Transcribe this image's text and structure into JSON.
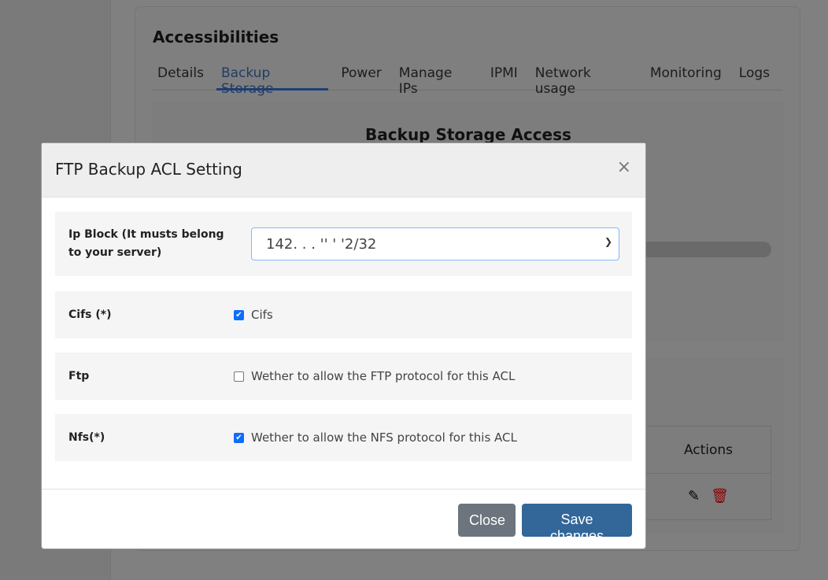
{
  "background": {
    "section_title": "Accessibilities",
    "tabs": [
      {
        "label": "Details"
      },
      {
        "label": "Backup Storage",
        "active": true
      },
      {
        "label": "Power"
      },
      {
        "label": "Manage IPs"
      },
      {
        "label": "IPMI"
      },
      {
        "label": "Network usage"
      },
      {
        "label": "Monitoring"
      },
      {
        "label": "Logs"
      }
    ],
    "panel_title": "Backup Storage Access",
    "table_header_actions": "Actions"
  },
  "modal": {
    "title": "FTP Backup ACL Setting",
    "close_icon": "×",
    "ip_block": {
      "label": "Ip Block (It musts belong to your server)",
      "value": "142. . . '' ' '2/32"
    },
    "cifs": {
      "label": "Cifs (*)",
      "checkbox_label": "Cifs",
      "checked": true
    },
    "ftp": {
      "label": "Ftp",
      "checkbox_label": "Wether to allow the FTP protocol for this ACL",
      "checked": false
    },
    "nfs": {
      "label": "Nfs(*)",
      "checkbox_label": "Wether to allow the NFS protocol for this ACL",
      "checked": true
    },
    "close_label": "Close",
    "save_label": "Save changes"
  },
  "colors": {
    "primary": "#336699",
    "secondary": "#6c757d",
    "delete": "#c00000"
  }
}
